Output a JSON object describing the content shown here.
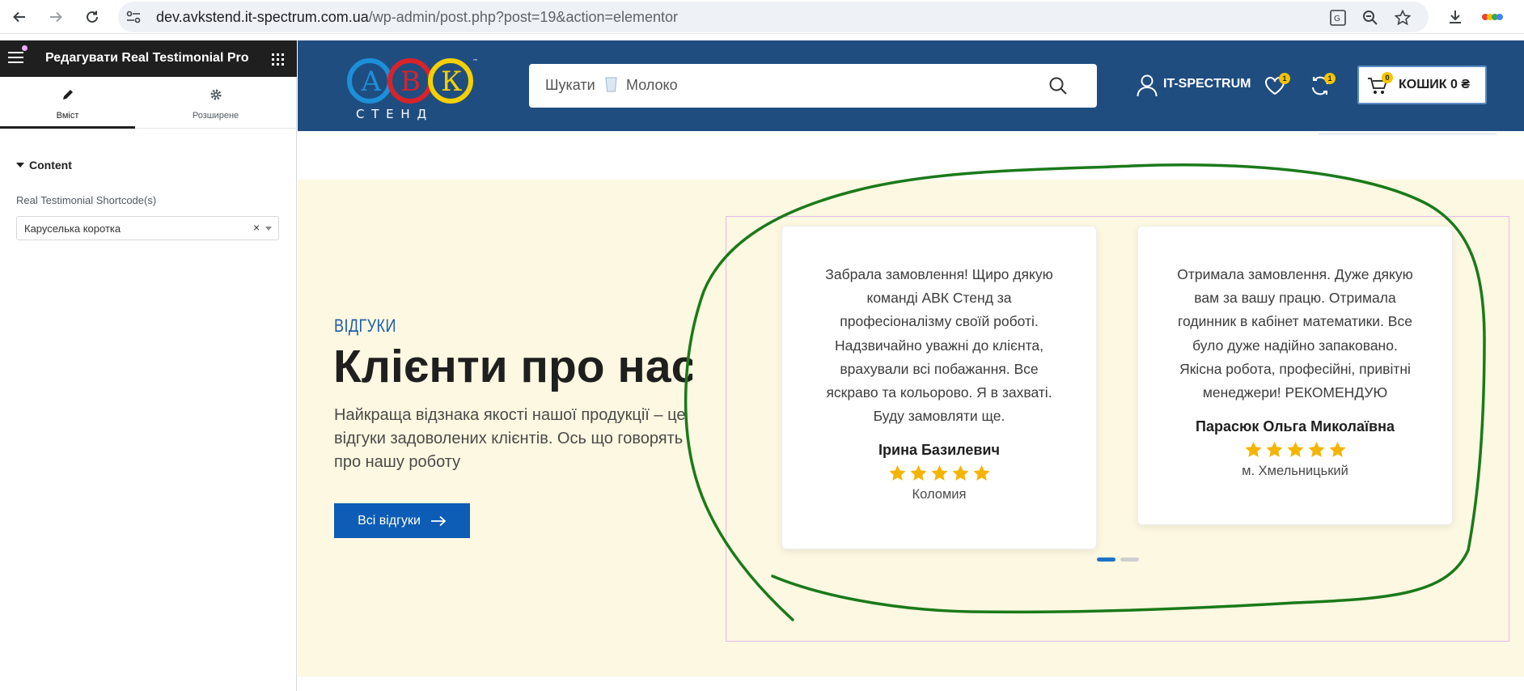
{
  "browser": {
    "url_host": "dev.avkstend.it-spectrum.com.ua",
    "url_path": "/wp-admin/post.php?post=19&action=elementor",
    "icons": [
      "back-arrow-icon",
      "forward-arrow-icon",
      "reload-icon",
      "site-info-icon",
      "translate-icon",
      "zoom-icon",
      "star-icon",
      "download-icon",
      "profile-icon"
    ]
  },
  "panel": {
    "title": "Редагувати Real Testimonial Pro",
    "tabs": [
      {
        "label": "Вміст",
        "icon": "pencil-icon",
        "active": true
      },
      {
        "label": "Розширене",
        "icon": "gear-icon",
        "active": false
      }
    ],
    "section_title": "Content",
    "control_label": "Real Testimonial Shortcode(s)",
    "control_value": "Каруселька коротка",
    "control_clear": "×"
  },
  "site": {
    "logo_letters": [
      "А",
      "В",
      "К"
    ],
    "logo_sub": "С Т Е Н Д",
    "logo_tm": "™",
    "search_placeholder_prefix": "Шукати",
    "search_placeholder_item": "Молоко",
    "account_name": "IT-SPECTRUM",
    "wishlist_count": "1",
    "compare_count": "1",
    "cart_count": "0",
    "cart_label": "КОШИК 0 ₴"
  },
  "section": {
    "eyebrow": "ВІДГУКИ",
    "heading": "Клієнти про нас",
    "subtext_lines": [
      "Найкраща відзнака якості нашої продукції – це",
      "відгуки задоволених клієнтів. Ось що говорять",
      "про нашу роботу"
    ],
    "cta_label": "Всі відгуки"
  },
  "testimonials": [
    {
      "quote_lines": [
        "Забрала замовлення! Щиро дякую",
        "команді АВК Стенд за",
        "професіоналізму своїй роботі.",
        "Надзвичайно уважні до клієнта,",
        "врахували всі побажання. Все",
        "яскраво та кольорово. Я в захваті.",
        "Буду замовляти ще."
      ],
      "author": "Ірина Базилевич",
      "rating": 5,
      "city": "Коломия"
    },
    {
      "quote_lines": [
        "Отримала замовлення. Дуже дякую",
        "вам за вашу працю. Отримала",
        "годинник в кабінет математики. Все",
        "було дуже надійно запаковано.",
        "Якісна робота, професійні, привітні",
        "менеджери! РЕКОМЕНДУЮ"
      ],
      "author": "Парасюк Ольга Миколаївна",
      "rating": 5,
      "city": "м. Хмельницький"
    }
  ],
  "carousel": {
    "pages": 2,
    "active_page": 1
  },
  "colors": {
    "header_bg": "#1f4d80",
    "accent_blue": "#0d5cb5",
    "section_bg": "#fdf8e1",
    "star": "#f5b400",
    "annotation": "#1a7a1a"
  }
}
